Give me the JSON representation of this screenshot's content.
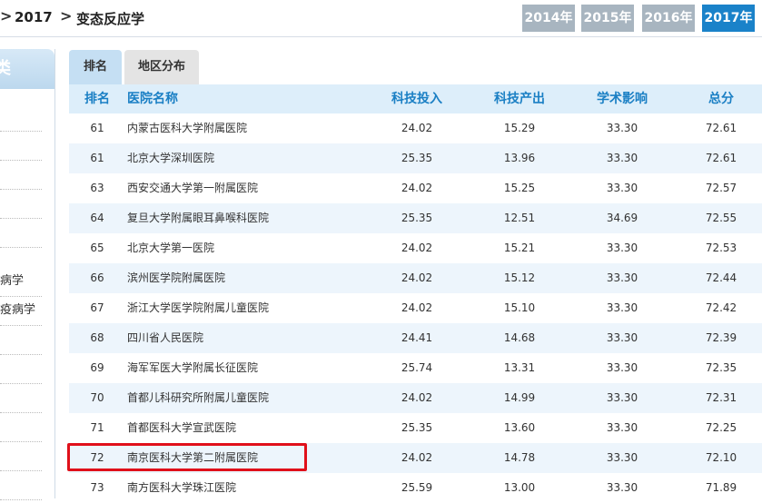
{
  "breadcrumb": {
    "year": "2017",
    "category": "变态反应学"
  },
  "year_tabs": [
    {
      "label": "2014年",
      "active": false
    },
    {
      "label": "2015年",
      "active": false
    },
    {
      "label": "2016年",
      "active": false
    },
    {
      "label": "2017年",
      "active": true
    }
  ],
  "sidebar": {
    "header": "类",
    "items": [
      "",
      "",
      "",
      "",
      "",
      "病学",
      "疫病学",
      "",
      "",
      "",
      "",
      "",
      ""
    ]
  },
  "tabs": {
    "rank": "排名",
    "region": "地区分布"
  },
  "table": {
    "headers": {
      "rank": "排名",
      "name": "医院名称",
      "tech_input": "科技投入",
      "tech_output": "科技产出",
      "academic": "学术影响",
      "total": "总分"
    },
    "rows": [
      {
        "rank": "61",
        "name": "内蒙古医科大学附属医院",
        "tech_input": "24.02",
        "tech_output": "15.29",
        "academic": "33.30",
        "total": "72.61"
      },
      {
        "rank": "61",
        "name": "北京大学深圳医院",
        "tech_input": "25.35",
        "tech_output": "13.96",
        "academic": "33.30",
        "total": "72.61"
      },
      {
        "rank": "63",
        "name": "西安交通大学第一附属医院",
        "tech_input": "24.02",
        "tech_output": "15.25",
        "academic": "33.30",
        "total": "72.57"
      },
      {
        "rank": "64",
        "name": "复旦大学附属眼耳鼻喉科医院",
        "tech_input": "25.35",
        "tech_output": "12.51",
        "academic": "34.69",
        "total": "72.55"
      },
      {
        "rank": "65",
        "name": "北京大学第一医院",
        "tech_input": "24.02",
        "tech_output": "15.21",
        "academic": "33.30",
        "total": "72.53"
      },
      {
        "rank": "66",
        "name": "滨州医学院附属医院",
        "tech_input": "24.02",
        "tech_output": "15.12",
        "academic": "33.30",
        "total": "72.44"
      },
      {
        "rank": "67",
        "name": "浙江大学医学院附属儿童医院",
        "tech_input": "24.02",
        "tech_output": "15.10",
        "academic": "33.30",
        "total": "72.42"
      },
      {
        "rank": "68",
        "name": "四川省人民医院",
        "tech_input": "24.41",
        "tech_output": "14.68",
        "academic": "33.30",
        "total": "72.39"
      },
      {
        "rank": "69",
        "name": "海军军医大学附属长征医院",
        "tech_input": "25.74",
        "tech_output": "13.31",
        "academic": "33.30",
        "total": "72.35"
      },
      {
        "rank": "70",
        "name": "首都儿科研究所附属儿童医院",
        "tech_input": "24.02",
        "tech_output": "14.99",
        "academic": "33.30",
        "total": "72.31"
      },
      {
        "rank": "71",
        "name": "首都医科大学宣武医院",
        "tech_input": "25.35",
        "tech_output": "13.60",
        "academic": "33.30",
        "total": "72.25"
      },
      {
        "rank": "72",
        "name": "南京医科大学第二附属医院",
        "tech_input": "24.02",
        "tech_output": "14.78",
        "academic": "33.30",
        "total": "72.10",
        "highlighted": true
      },
      {
        "rank": "73",
        "name": "南方医科大学珠江医院",
        "tech_input": "25.59",
        "tech_output": "13.00",
        "academic": "33.30",
        "total": "71.89"
      }
    ]
  },
  "colors": {
    "accent": "#1a82c9",
    "inactive_year": "#a8b5c0",
    "highlight": "#e0101a",
    "header_text": "#1a7fc4"
  }
}
